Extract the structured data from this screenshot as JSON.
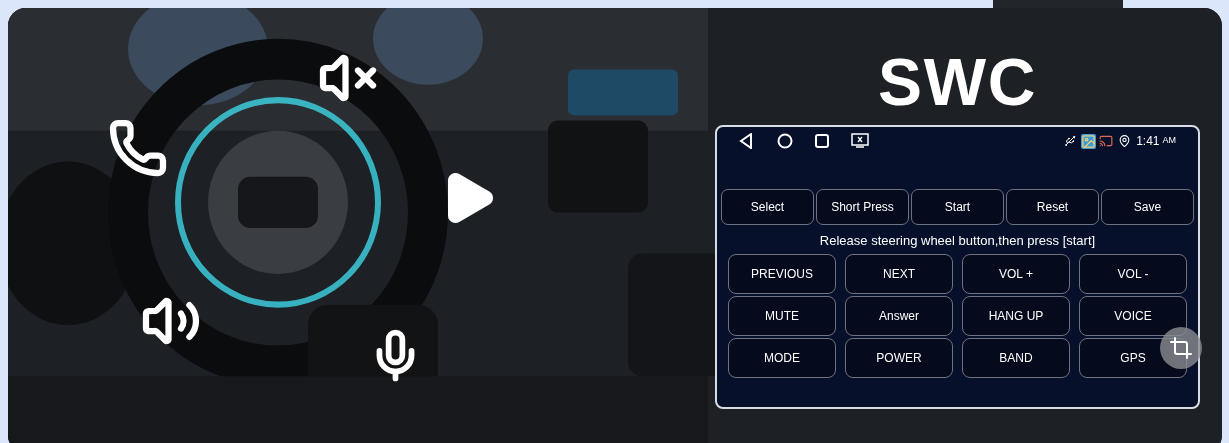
{
  "banner": {
    "kind": "picture",
    "heading": "SWC"
  },
  "screen": {
    "status_bar": {
      "time": "1:41",
      "period": "AM"
    },
    "actions": [
      {
        "label": "Select"
      },
      {
        "label": "Short Press"
      },
      {
        "label": "Start"
      },
      {
        "label": "Reset"
      },
      {
        "label": "Save"
      }
    ],
    "instruction": "Release steering wheel button,then press [start]",
    "keys": [
      {
        "label": "PREVIOUS"
      },
      {
        "label": "NEXT"
      },
      {
        "label": "VOL +"
      },
      {
        "label": "VOL -"
      },
      {
        "label": "MUTE"
      },
      {
        "label": "Answer"
      },
      {
        "label": "HANG UP"
      },
      {
        "label": "VOICE"
      },
      {
        "label": "MODE"
      },
      {
        "label": "POWER"
      },
      {
        "label": "BAND"
      },
      {
        "label": "GPS"
      }
    ]
  }
}
